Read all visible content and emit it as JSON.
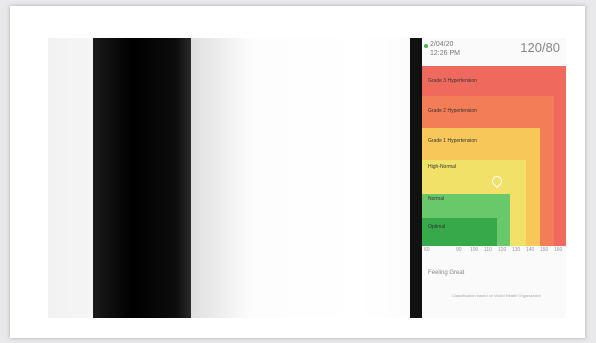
{
  "device": {
    "header": {
      "date": "2/04/20",
      "time": "12:26 PM",
      "reading": "120/80"
    },
    "zones": {
      "grade3": "Grade 3 Hypertension",
      "grade2": "Grade 2 Hypertension",
      "grade1": "Grade 1 Hypertension",
      "high_normal": "High-Normal",
      "normal": "Normal",
      "optimal": "Optimal"
    },
    "axis": {
      "start": "60",
      "ticks": [
        "90",
        "100",
        "110",
        "120",
        "130",
        "140",
        "150",
        "160"
      ]
    },
    "feeling": "Feeling Great",
    "footnote": "Classification based on World Health Organization"
  },
  "colors": {
    "grade3": "#ef6a5d",
    "grade2": "#f37d56",
    "grade1": "#f7c75a",
    "high_normal": "#f2e168",
    "normal": "#68c86a",
    "optimal": "#36a94a"
  },
  "icons": [
    "location-pin-icon"
  ]
}
